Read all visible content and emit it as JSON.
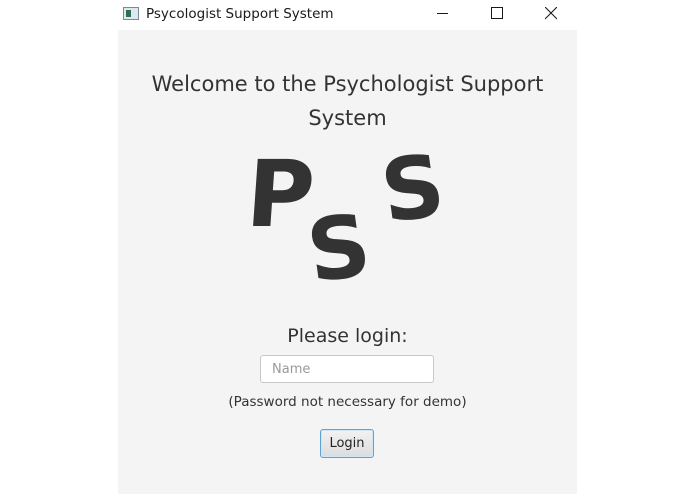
{
  "window": {
    "title": "Psycologist Support System"
  },
  "header": {
    "welcome_line1": "Welcome to the Psychologist Support",
    "welcome_line2": "System"
  },
  "logo": {
    "letter1": "P",
    "letter2": "S",
    "letter3": "S",
    "color": "#333333"
  },
  "login": {
    "prompt": "Please login:",
    "name_placeholder": "Name",
    "name_value": "",
    "note": "(Password not necessary for demo)",
    "button_label": "Login"
  },
  "colors": {
    "background": "#f4f4f4",
    "button_focus_border": "#5fa3d6",
    "text": "#333333"
  }
}
